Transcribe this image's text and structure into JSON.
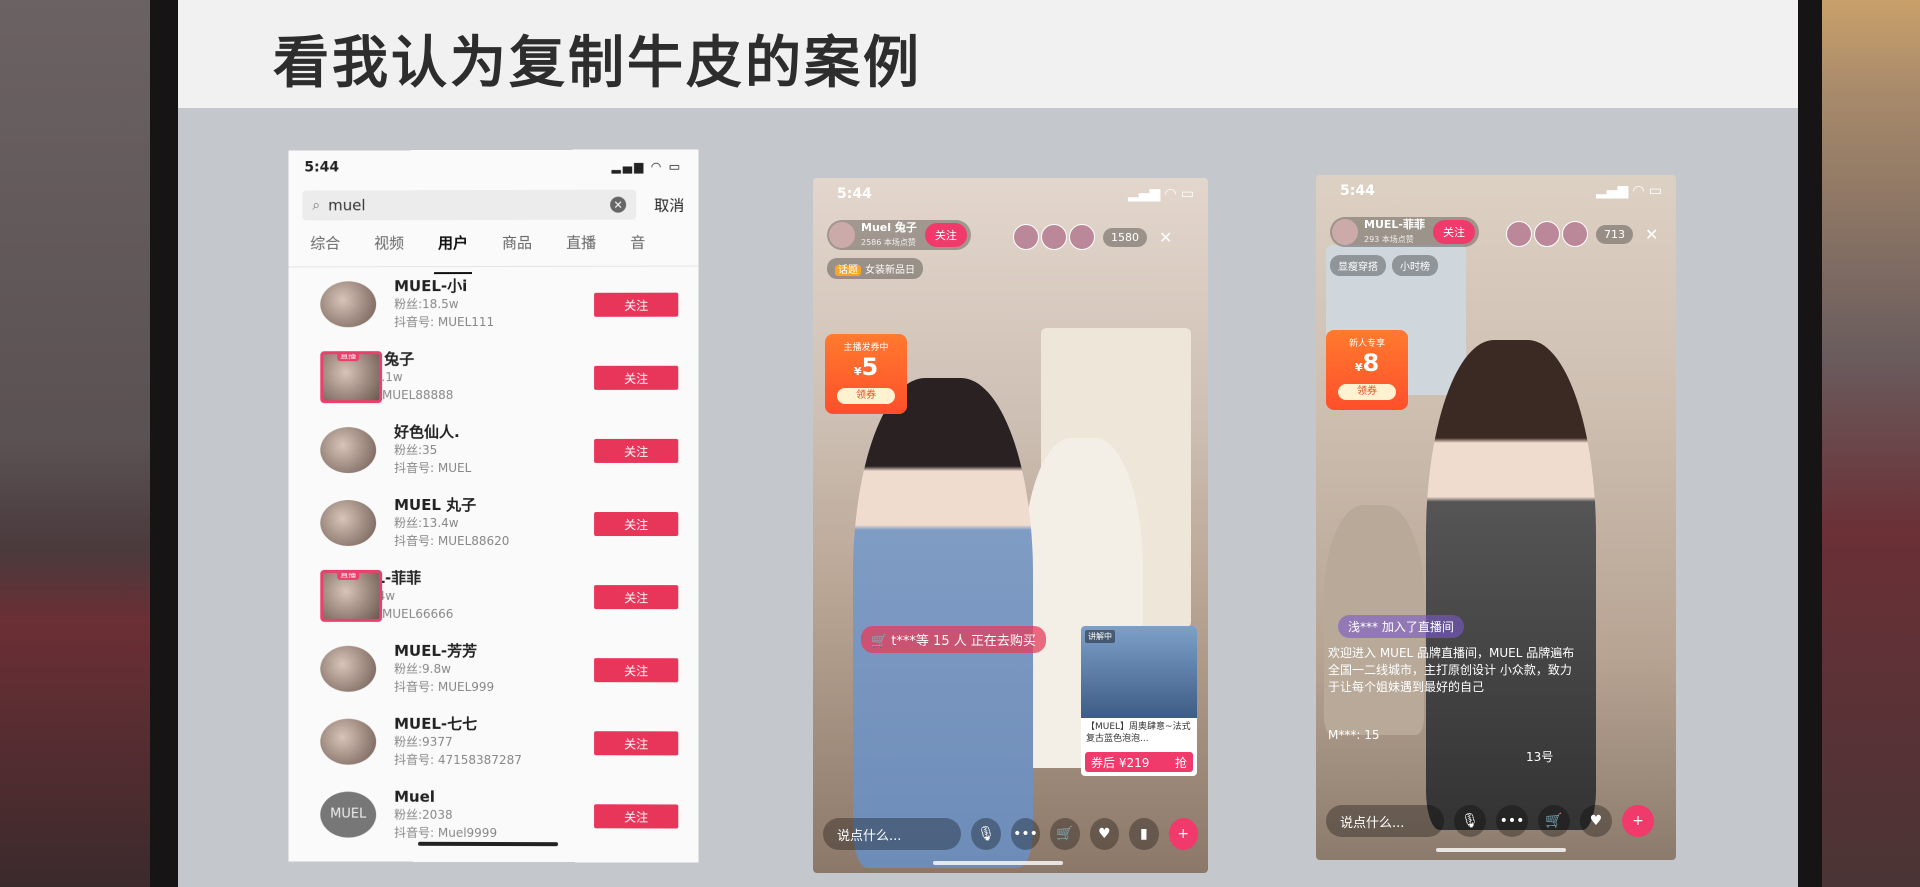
{
  "slide": {
    "title": "看我认为复制牛皮的案例"
  },
  "search_phone": {
    "time": "5:44",
    "query": "muel",
    "cancel": "取消",
    "tabs": [
      "综合",
      "视频",
      "用户",
      "商品",
      "直播",
      "音"
    ],
    "active_tab": "用户",
    "users": [
      {
        "name": "MUEL-小i",
        "fans": "粉丝:18.5w",
        "id": "抖音号: MUEL111",
        "follow": "关注",
        "live": false
      },
      {
        "name": "Muel 兔子",
        "fans": "粉丝:12.1w",
        "id": "抖音号: MUEL88888",
        "follow": "关注",
        "live": true
      },
      {
        "name": "好色仙人.",
        "fans": "粉丝:35",
        "id": "抖音号: MUEL",
        "follow": "关注",
        "live": false
      },
      {
        "name": "MUEL 丸子",
        "fans": "粉丝:13.4w",
        "id": "抖音号: MUEL88620",
        "follow": "关注",
        "live": false
      },
      {
        "name": "MUEL-菲菲",
        "fans": "粉丝:8.4w",
        "id": "抖音号: MUEL66666",
        "follow": "关注",
        "live": true
      },
      {
        "name": "MUEL-芳芳",
        "fans": "粉丝:9.8w",
        "id": "抖音号: MUEL999",
        "follow": "关注",
        "live": false
      },
      {
        "name": "MUEL-七七",
        "fans": "粉丝:9377",
        "id": "抖音号: 47158387287",
        "follow": "关注",
        "live": false
      },
      {
        "name": "Muel",
        "fans": "粉丝:2038",
        "id": "抖音号: Muel9999",
        "follow": "关注",
        "live": false,
        "avatar_text": "MUEL"
      }
    ]
  },
  "live_phone_1": {
    "time": "5:44",
    "host_name": "Muel 兔子",
    "host_meta": "2586 本场点赞",
    "follow": "关注",
    "viewers": "1580",
    "tag_hot": "话题",
    "tag_text": "女装新品日",
    "coupon_top": "主播发券中",
    "coupon_amount": "5",
    "coupon_btn": "领券",
    "buying": "t***等 15 人 正在去购买",
    "product_badge": "讲解中",
    "product_desc": "【MUEL】周奥肆意~法式复古蓝色泡泡...",
    "product_price": "券后 ¥219",
    "product_grab": "抢",
    "say": "说点什么..."
  },
  "live_phone_2": {
    "time": "5:44",
    "host_name": "MUEL-菲菲",
    "host_meta": "293 本场点赞",
    "follow": "关注",
    "viewers": "713",
    "tag1": "显瘦穿搭",
    "tag2": "小时榜",
    "coupon_top": "新人专享",
    "coupon_amount": "8",
    "coupon_btn": "领券",
    "joined": "浅*** 加入了直播间",
    "welcome": "欢迎进入 MUEL 品牌直播间，MUEL 品牌遍布全国一二线城市，主打原创设计 小众款，致力于让每个姐妹遇到最好的自己",
    "chat_line1": "M***: 15",
    "chat_line2": "13号",
    "say": "说点什么..."
  }
}
